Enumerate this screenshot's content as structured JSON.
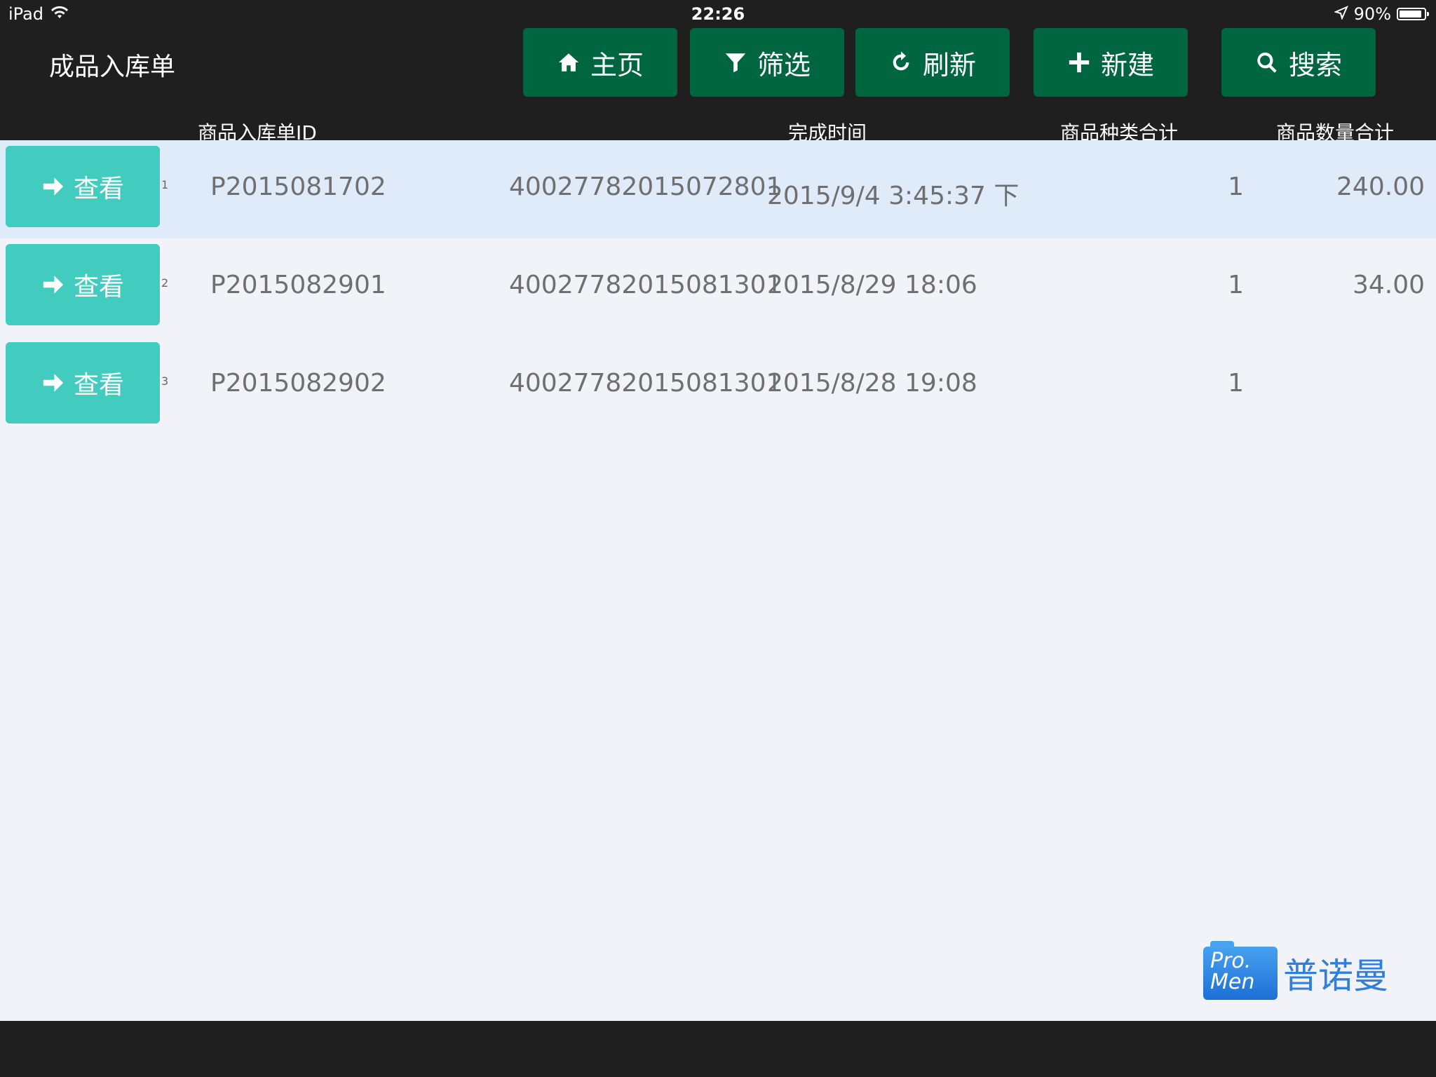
{
  "status_bar": {
    "device": "iPad",
    "time": "22:26",
    "battery": "90%",
    "battery_level": 0.9
  },
  "header": {
    "title": "成品入库单",
    "buttons": {
      "home": "主页",
      "filter": "筛选",
      "refresh": "刷新",
      "new": "新建",
      "search": "搜索"
    }
  },
  "columns": {
    "id": "商品入库单ID",
    "finish_time": "完成时间",
    "kind_total": "商品种类合计",
    "qty_total": "商品数量合计"
  },
  "rows": [
    {
      "index": "1",
      "view": "查看",
      "id": "P2015081702",
      "code": "40027782015072801",
      "time": "2015/9/4 3:45:37 下",
      "kinds": "1",
      "qty": "240.00",
      "selected": true
    },
    {
      "index": "2",
      "view": "查看",
      "id": "P2015082901",
      "code": "40027782015081301",
      "time": "2015/8/29 18:06",
      "kinds": "1",
      "qty": "34.00",
      "selected": false
    },
    {
      "index": "3",
      "view": "查看",
      "id": "P2015082902",
      "code": "40027782015081301",
      "time": "2015/8/28 19:08",
      "kinds": "1",
      "qty": "",
      "selected": false
    }
  ],
  "logo": {
    "mark_line1": "Pro.",
    "mark_line2": "Men",
    "text": "普诺曼"
  }
}
